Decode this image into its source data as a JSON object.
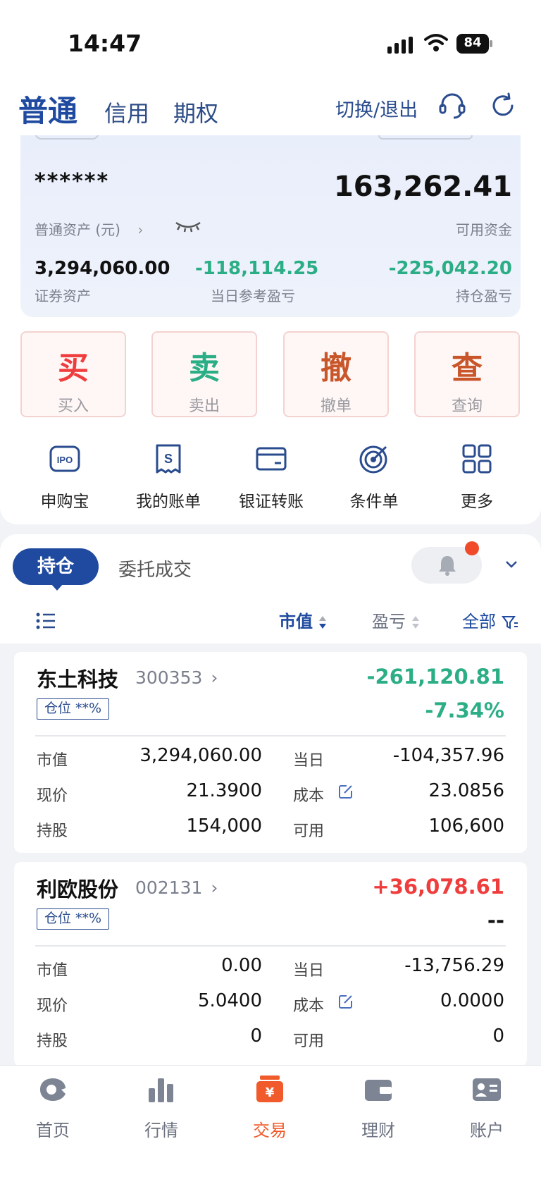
{
  "status_bar": {
    "time": "14:47",
    "battery": "84"
  },
  "header": {
    "tab_normal": "普通",
    "tab_credit": "信用",
    "tab_options": "期权",
    "switch_exit": "切换/退出"
  },
  "assets": {
    "masked_total": "******",
    "total_label": "普通资产 (元)",
    "available_funds": "163,262.41",
    "available_label": "可用资金",
    "securities_value": "3,294,060.00",
    "securities_label": "证券资产",
    "daily_pnl": "-118,114.25",
    "daily_pnl_label": "当日参考盈亏",
    "position_pnl": "-225,042.20",
    "position_pnl_label": "持仓盈亏"
  },
  "actions": [
    {
      "big": "买",
      "small": "买入",
      "color": "#ef3d3d"
    },
    {
      "big": "卖",
      "small": "卖出",
      "color": "#2bae86"
    },
    {
      "big": "撤",
      "small": "撤单",
      "color": "#c8562a"
    },
    {
      "big": "查",
      "small": "查询",
      "color": "#c8562a"
    }
  ],
  "quick_links": [
    {
      "label": "申购宝",
      "icon": "ipo-icon"
    },
    {
      "label": "我的账单",
      "icon": "bill-icon"
    },
    {
      "label": "银证转账",
      "icon": "card-icon"
    },
    {
      "label": "条件单",
      "icon": "target-icon"
    },
    {
      "label": "更多",
      "icon": "grid-icon"
    }
  ],
  "holdings": {
    "tab_positions": "持仓",
    "tab_orders": "委托成交",
    "sort_market_value": "市值",
    "sort_pnl": "盈亏",
    "filter_all": "全部"
  },
  "stocks": [
    {
      "name": "东土科技",
      "code": "300353",
      "position": "仓位 **%",
      "pnl": "-261,120.81",
      "pnl_pct": "-7.34%",
      "labels": {
        "market_value": "市值",
        "price": "现价",
        "shares": "持股",
        "daily": "当日",
        "cost": "成本",
        "available": "可用"
      },
      "market_value": "3,294,060.00",
      "price": "21.3900",
      "shares": "154,000",
      "daily": "-104,357.96",
      "cost": "23.0856",
      "available": "106,600"
    },
    {
      "name": "利欧股份",
      "code": "002131",
      "position": "仓位 **%",
      "pnl": "+36,078.61",
      "pnl_pct": "--",
      "labels": {
        "market_value": "市值",
        "price": "现价",
        "shares": "持股",
        "daily": "当日",
        "cost": "成本",
        "available": "可用"
      },
      "market_value": "0.00",
      "price": "5.0400",
      "shares": "0",
      "daily": "-13,756.29",
      "cost": "0.0000",
      "available": "0"
    }
  ],
  "bottom_nav": [
    {
      "label": "首页",
      "icon": "home-icon"
    },
    {
      "label": "行情",
      "icon": "market-chart-icon"
    },
    {
      "label": "交易",
      "icon": "trade-icon"
    },
    {
      "label": "理财",
      "icon": "wallet-icon"
    },
    {
      "label": "账户",
      "icon": "account-card-icon"
    }
  ],
  "colors": {
    "brand": "#1f4aa0",
    "rise": "#ef3d3d",
    "fall": "#2bae86",
    "nav_active": "#f15a2a"
  }
}
